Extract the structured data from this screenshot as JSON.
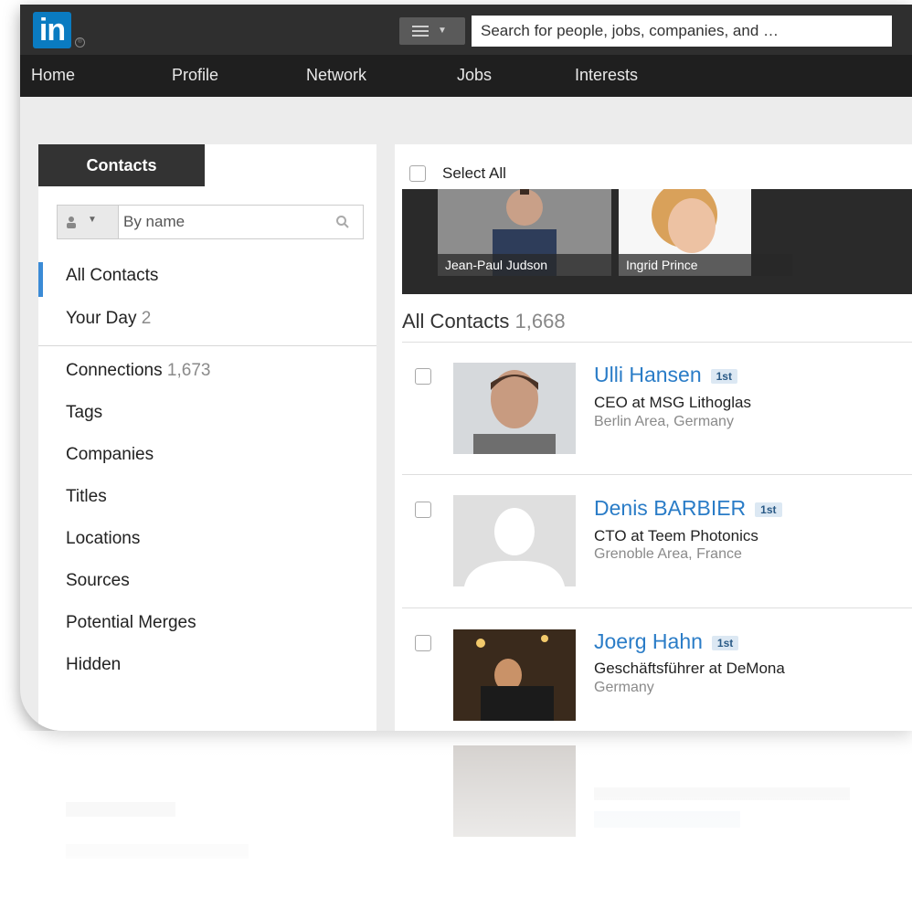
{
  "app": {
    "logo_text": "in"
  },
  "search": {
    "placeholder": "Search for people, jobs, companies, and …"
  },
  "nav": {
    "items": [
      "Home",
      "Profile",
      "Network",
      "Jobs",
      "Interests"
    ]
  },
  "sidebar": {
    "tab_label": "Contacts",
    "filter": {
      "placeholder": "By name"
    },
    "items": [
      {
        "label": "All Contacts",
        "count": ""
      },
      {
        "label": "Your Day",
        "count": "2"
      },
      {
        "label": "Connections",
        "count": "1,673"
      },
      {
        "label": "Tags",
        "count": ""
      },
      {
        "label": "Companies",
        "count": ""
      },
      {
        "label": "Titles",
        "count": ""
      },
      {
        "label": "Locations",
        "count": ""
      },
      {
        "label": "Sources",
        "count": ""
      },
      {
        "label": "Potential Merges",
        "count": ""
      },
      {
        "label": "Hidden",
        "count": ""
      }
    ]
  },
  "main": {
    "select_all_label": "Select All",
    "highlights": [
      "Jean-Paul Judson",
      "Ingrid Prince"
    ],
    "section_title": "All Contacts",
    "section_count": "1,668",
    "contacts": [
      {
        "name": "Ulli Hansen",
        "degree": "1st",
        "title": "CEO at MSG Lithoglas",
        "location": "Berlin Area, Germany"
      },
      {
        "name": "Denis BARBIER",
        "degree": "1st",
        "title": "CTO at Teem Photonics",
        "location": "Grenoble Area, France"
      },
      {
        "name": "Joerg Hahn",
        "degree": "1st",
        "title": "Geschäftsführer at DeMona",
        "location": "Germany"
      }
    ]
  },
  "colors": {
    "brand": "#0a7bc1",
    "link": "#2a7cc7",
    "active": "#3b8bd6",
    "topbar": "#2f2f2f",
    "navbar": "#1f1f1f"
  }
}
